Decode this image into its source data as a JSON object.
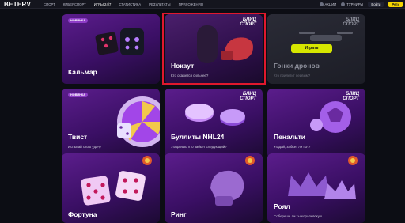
{
  "header": {
    "logo": "BETERV",
    "nav": [
      {
        "label": "СПОРТ"
      },
      {
        "label": "КИБЕРСПОРТ"
      },
      {
        "label": "ИГРЫ 24/7"
      },
      {
        "label": "СТАТИСТИКА"
      },
      {
        "label": "РЕЗУЛЬТАТЫ"
      },
      {
        "label": "ПРИЛОЖЕНИЯ"
      }
    ],
    "promos_label": "АКЦИИ",
    "tournaments_label": "ТУРНИРЫ",
    "login_label": "Войти",
    "register_label": "Реги"
  },
  "cards": [
    {
      "title": "Кальмар",
      "subtitle": "",
      "badge": "НОВИНКА",
      "blitz": ""
    },
    {
      "title": "Нокаут",
      "subtitle": "Кто окажется сильнее?",
      "badge": "",
      "blitz": "БЛИЦ\nСПОРТ"
    },
    {
      "title": "Гонки дронов",
      "subtitle": "Кто прилетит первым?",
      "badge": "",
      "blitz": "БЛИЦ\nСПОРТ",
      "button": "Играть"
    },
    {
      "title": "Твист",
      "subtitle": "Испытай свою удачу",
      "badge": "НОВИНКА",
      "blitz": ""
    },
    {
      "title": "Буллиты NHL24",
      "subtitle": "Угадаешь, кто забьет следующий?",
      "badge": "",
      "blitz": "БЛИЦ\nСПОРТ"
    },
    {
      "title": "Пенальти",
      "subtitle": "Угадай, забьет ли гол?",
      "badge": "",
      "blitz": "БЛИЦ\nСПОРТ"
    },
    {
      "title": "Фортуна",
      "subtitle": "",
      "badge": "",
      "blitz": ""
    },
    {
      "title": "Ринг",
      "subtitle": "",
      "badge": "",
      "blitz": ""
    },
    {
      "title": "Роял",
      "subtitle": "Соберешь ли ты королевскую",
      "badge": "",
      "blitz": ""
    }
  ]
}
